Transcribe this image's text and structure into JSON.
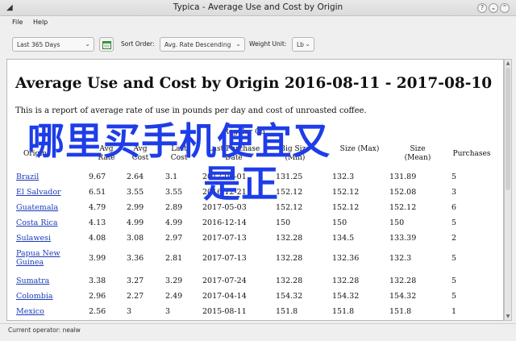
{
  "window": {
    "title": "Typica - Average Use and Cost by Origin"
  },
  "menubar": {
    "file": "File",
    "help": "Help"
  },
  "toolbar": {
    "date_range": "Last 365 Days",
    "sort_label": "Sort Order:",
    "sort_value": "Avg. Rate Descending",
    "weight_label": "Weight Unit:",
    "weight_value": "Lb"
  },
  "report": {
    "title": "Average Use and Cost by Origin 2016-08-11 - 2017-08-10",
    "description": "This is a report of average rate of use in pounds per day and cost of unroasted coffee.",
    "group_header": "Regular Co",
    "columns": [
      "Origin",
      "Avg Rate",
      "Avg Cost",
      "Last Cost",
      "Last Purchase Date",
      "Big Size (Min)",
      "Size (Max)",
      "Size (Mean)",
      "Purchases"
    ],
    "rows": [
      [
        "Brazil",
        "9.67",
        "2.64",
        "3.1",
        "2017-06-01",
        "131.25",
        "132.3",
        "131.89",
        "5"
      ],
      [
        "El Salvador",
        "6.51",
        "3.55",
        "3.55",
        "2016-12-21",
        "152.12",
        "152.12",
        "152.08",
        "3"
      ],
      [
        "Guatemala",
        "4.79",
        "2.99",
        "2.89",
        "2017-05-03",
        "152.12",
        "152.12",
        "152.12",
        "6"
      ],
      [
        "Costa Rica",
        "4.13",
        "4.99",
        "4.99",
        "2016-12-14",
        "150",
        "150",
        "150",
        "5"
      ],
      [
        "Sulawesi",
        "4.08",
        "3.08",
        "2.97",
        "2017-07-13",
        "132.28",
        "134.5",
        "133.39",
        "2"
      ],
      [
        "Papua New Guinea",
        "3.99",
        "3.36",
        "2.81",
        "2017-07-13",
        "132.28",
        "132.36",
        "132.3",
        "5"
      ],
      [
        "Sumatra",
        "3.38",
        "3.27",
        "3.29",
        "2017-07-24",
        "132.28",
        "132.28",
        "132.28",
        "5"
      ],
      [
        "Colombia",
        "2.96",
        "2.27",
        "2.49",
        "2017-04-14",
        "154.32",
        "154.32",
        "154.32",
        "5"
      ],
      [
        "Mexico",
        "2.56",
        "3",
        "3",
        "2015-08-11",
        "151.8",
        "151.8",
        "151.8",
        "1"
      ]
    ]
  },
  "overlay": {
    "line1": "哪里买手机便宜又",
    "line2": "是正"
  },
  "status": {
    "operator": "Current operator: nealw"
  },
  "icons": {
    "app": "app-icon",
    "calendar": "calendar-icon",
    "help": "help-icon",
    "minimize": "minimize-icon",
    "maximize": "maximize-icon",
    "close": "close-icon"
  },
  "colors": {
    "link": "#1a3bb8",
    "overlay_text": "#1e3de8"
  }
}
